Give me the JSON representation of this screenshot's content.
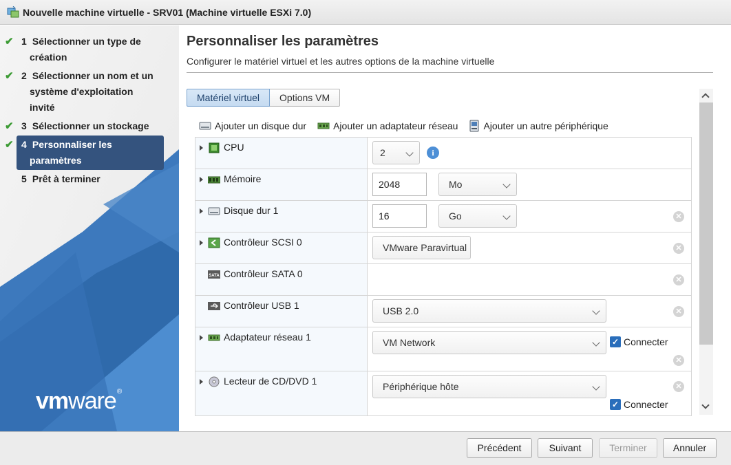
{
  "window": {
    "title": "Nouvelle machine virtuelle - SRV01 (Machine virtuelle ESXi 7.0)"
  },
  "sidebar": {
    "steps": [
      {
        "num": "1",
        "line1": "Sélectionner un type de",
        "line2": "création",
        "line3": "",
        "done": true
      },
      {
        "num": "2",
        "line1": "Sélectionner un nom et un",
        "line2": "système d'exploitation",
        "line3": "invité",
        "done": true
      },
      {
        "num": "3",
        "line1": "Sélectionner un stockage",
        "line2": "",
        "line3": "",
        "done": true
      },
      {
        "num": "4",
        "line1": "Personnaliser les",
        "line2": "paramètres",
        "line3": "",
        "done": true
      },
      {
        "num": "5",
        "line1": "Prêt à terminer",
        "line2": "",
        "line3": "",
        "done": false
      }
    ],
    "logo": {
      "bold": "vm",
      "rest": "ware",
      "reg": "®"
    },
    "colors": {
      "active_step": "#34537e",
      "check": "#3c9b34"
    }
  },
  "main": {
    "title": "Personnaliser les paramètres",
    "subtitle": "Configurer le matériel virtuel et les autres options de la machine virtuelle",
    "tabs": [
      "Matériel virtuel",
      "Options VM"
    ],
    "toolbar": {
      "add_disk": "Ajouter un disque dur",
      "add_network": "Ajouter un adaptateur réseau",
      "add_other": "Ajouter un autre périphérique"
    },
    "devices": {
      "cpu": {
        "label": "CPU",
        "value": "2"
      },
      "memory": {
        "label": "Mémoire",
        "value": "2048",
        "unit": "Mo"
      },
      "disk": {
        "label": "Disque dur 1",
        "value": "16",
        "unit": "Go"
      },
      "scsi": {
        "label": "Contrôleur SCSI 0",
        "value": "VMware Paravirtual"
      },
      "sata": {
        "label": "Contrôleur SATA 0"
      },
      "usb": {
        "label": "Contrôleur USB 1",
        "value": "USB 2.0"
      },
      "network": {
        "label": "Adaptateur réseau 1",
        "value": "VM Network",
        "connect": "Connecter"
      },
      "cdrom": {
        "label": "Lecteur de CD/DVD 1",
        "value": "Périphérique hôte",
        "connect": "Connecter"
      }
    },
    "icons": {
      "sata_text": "SATA"
    }
  },
  "footer": {
    "prev": "Précédent",
    "next": "Suivant",
    "finish": "Terminer",
    "cancel": "Annuler"
  }
}
